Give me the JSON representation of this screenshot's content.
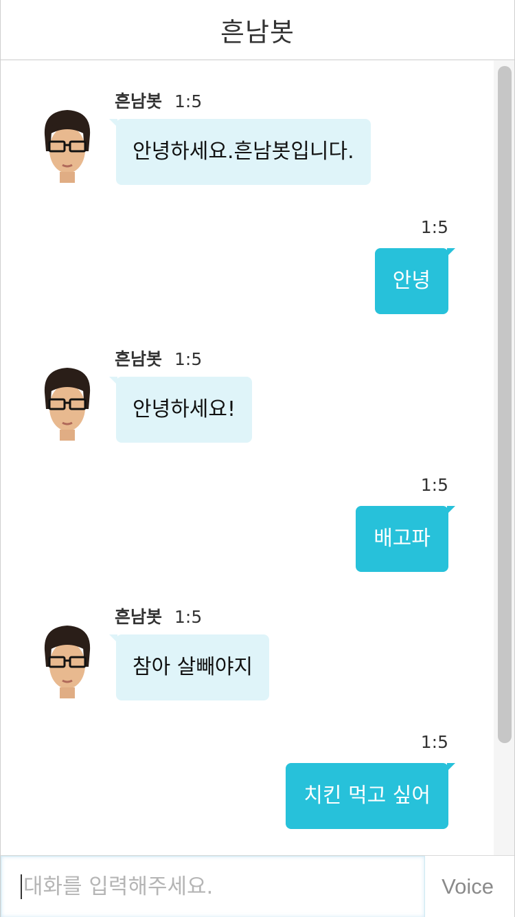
{
  "header": {
    "title": "흔남봇"
  },
  "messages": [
    {
      "sender": "bot",
      "name": "흔남봇",
      "time": "1:5",
      "text": "안녕하세요.흔남봇입니다."
    },
    {
      "sender": "user",
      "time": "1:5",
      "text": "안녕"
    },
    {
      "sender": "bot",
      "name": "흔남봇",
      "time": "1:5",
      "text": "안녕하세요!"
    },
    {
      "sender": "user",
      "time": "1:5",
      "text": "배고파"
    },
    {
      "sender": "bot",
      "name": "흔남봇",
      "time": "1:5",
      "text": "참아 살빼야지"
    },
    {
      "sender": "user",
      "time": "1:5",
      "text": "치킨 먹고 싶어"
    }
  ],
  "input": {
    "placeholder": "대화를 입력해주세요.",
    "value": ""
  },
  "voice_button": {
    "label": "Voice"
  },
  "colors": {
    "bot_bubble": "#dff4f9",
    "user_bubble": "#27c1da",
    "user_text": "#ffffff"
  }
}
